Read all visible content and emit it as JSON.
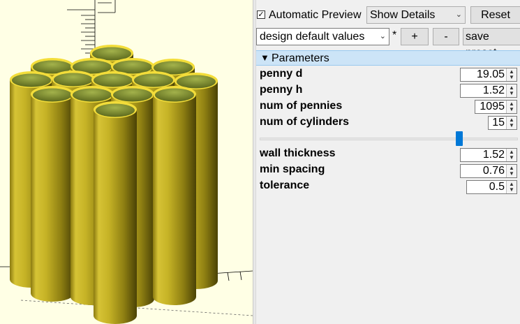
{
  "toolbar": {
    "auto_preview_label": "Automatic Preview",
    "auto_preview_checked": true,
    "details_select": "Show Details",
    "reset_label": "Reset",
    "preset_select": "design default values",
    "preset_modified_marker": "*",
    "add_preset_label": "+",
    "remove_preset_label": "-",
    "save_preset_label": "save preset"
  },
  "parameters": {
    "header": "Parameters",
    "items": [
      {
        "label": "penny d",
        "value": "19.05"
      },
      {
        "label": "penny h",
        "value": "1.52"
      },
      {
        "label": "num of pennies",
        "value": "1095"
      },
      {
        "label": "num of cylinders",
        "value": "15"
      },
      {
        "label": "wall thickness",
        "value": "1.52"
      },
      {
        "label": "min spacing",
        "value": "0.76"
      },
      {
        "label": "tolerance",
        "value": "0.5"
      }
    ]
  },
  "viewport": {
    "background": "#ffffe5",
    "model_color": "#c9b626",
    "model_rim_color": "#f3dd3a",
    "model_inner_color": "#8c9b3c"
  }
}
